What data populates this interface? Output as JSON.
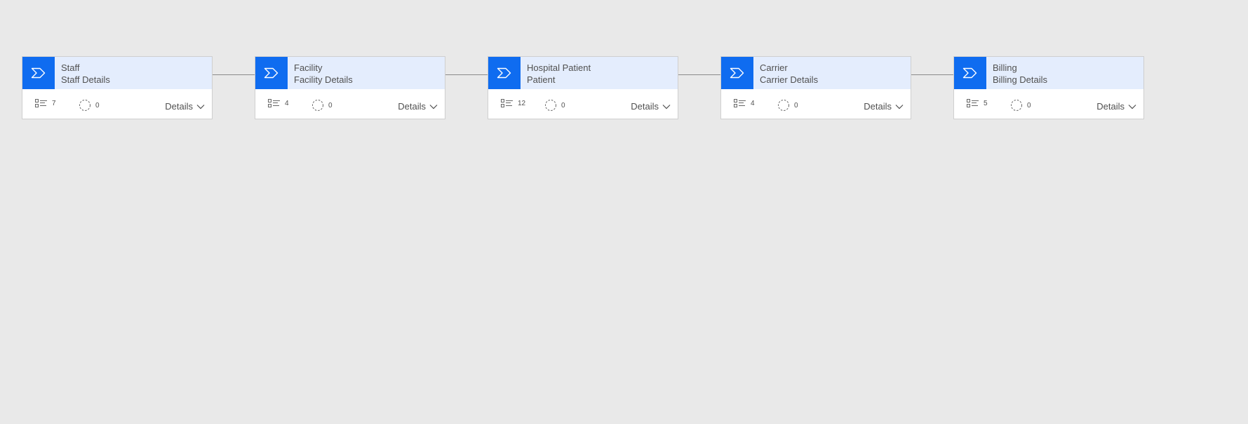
{
  "stages": [
    {
      "title": "Staff",
      "subtitle": "Staff Details",
      "steps": "7",
      "flows": "0",
      "details_label": "Details"
    },
    {
      "title": "Facility",
      "subtitle": "Facility Details",
      "steps": "4",
      "flows": "0",
      "details_label": "Details"
    },
    {
      "title": "Hospital Patient",
      "subtitle": "Patient",
      "steps": "12",
      "flows": "0",
      "details_label": "Details"
    },
    {
      "title": "Carrier",
      "subtitle": "Carrier Details",
      "steps": "4",
      "flows": "0",
      "details_label": "Details"
    },
    {
      "title": "Billing",
      "subtitle": "Billing Details",
      "steps": "5",
      "flows": "0",
      "details_label": "Details"
    }
  ],
  "icons": {
    "stage": "chevron-stage-icon",
    "steps": "steps-list-icon",
    "flows": "dashed-circle-icon",
    "details": "chevron-down-icon"
  },
  "colors": {
    "accent": "#0f6cf0",
    "header_bg": "#e4edfd",
    "canvas_bg": "#e9e9e9"
  }
}
